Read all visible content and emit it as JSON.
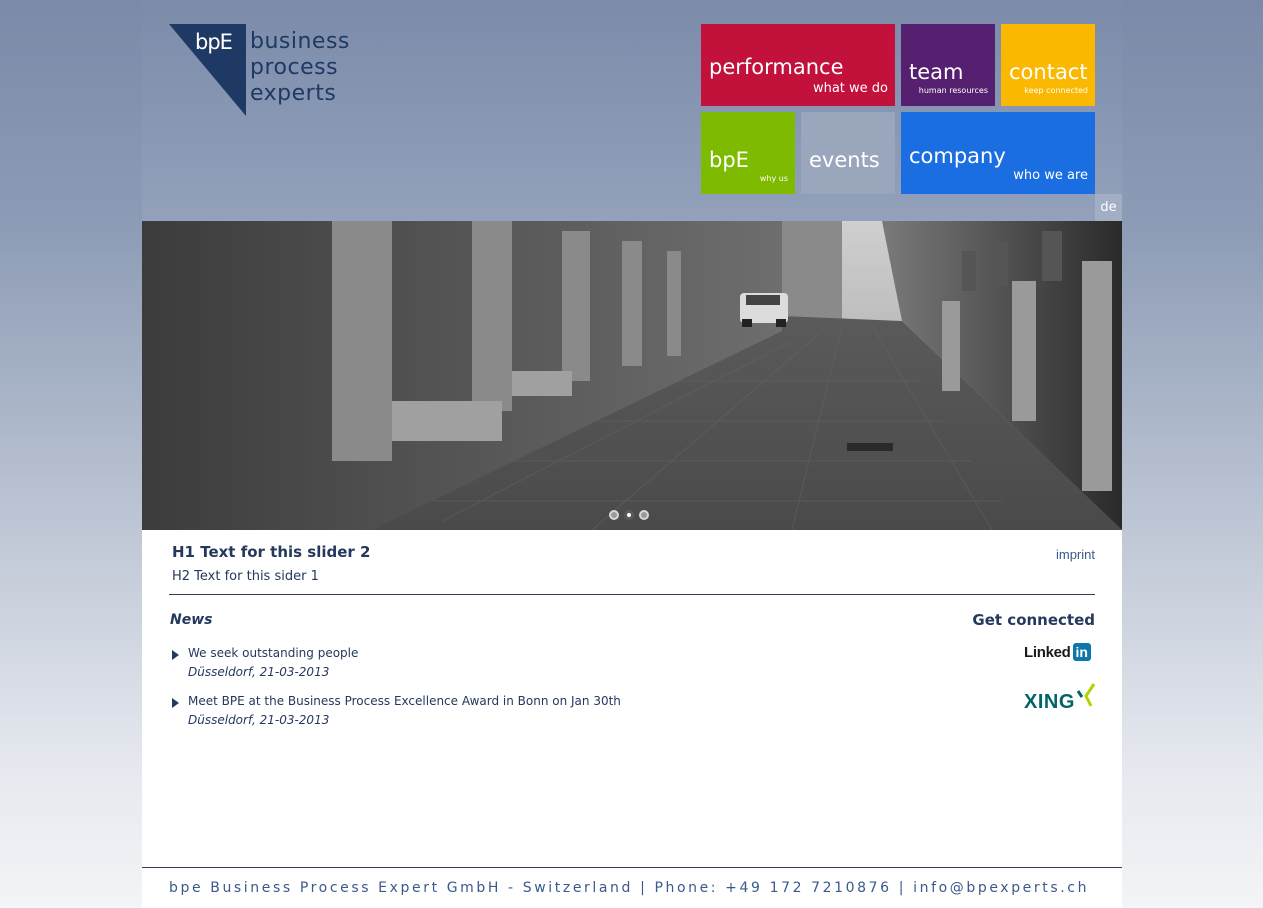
{
  "logo": {
    "mark": "bpE",
    "lines": [
      "business",
      "process",
      "experts"
    ]
  },
  "nav": {
    "performance": {
      "label": "performance",
      "sub": "what we do",
      "color": "#c2123c"
    },
    "team": {
      "label": "team",
      "sub": "human resources",
      "color": "#55206f"
    },
    "contact": {
      "label": "contact",
      "sub": "keep connected",
      "color": "#fbb800"
    },
    "bpe": {
      "label": "bpE",
      "sub": "why us",
      "color": "#7dba00"
    },
    "events": {
      "label": "events",
      "color": "#9aa6bb"
    },
    "company": {
      "label": "company",
      "sub": "who we are",
      "color": "#1b6ee2"
    }
  },
  "lang": "de",
  "slider": {
    "dots": 3,
    "active_index": 1
  },
  "content": {
    "h1": "H1 Text for this slider 2",
    "h2": "H2 Text for this sider 1",
    "imprint": "imprint"
  },
  "news": {
    "title": "News",
    "items": [
      {
        "title": "We seek outstanding people",
        "date": "Düsseldorf, 21-03-2013"
      },
      {
        "title": "Meet BPE at the Business Process Excellence Award in Bonn on Jan 30th",
        "date": "Düsseldorf, 21-03-2013"
      }
    ]
  },
  "social": {
    "title": "Get connected",
    "linkedin_text": "Linked",
    "linkedin_box": "in",
    "xing": "XING"
  },
  "footer": {
    "text": "bpe Business Process Expert GmbH - Switzerland | Phone: +49 172 7210876 | info@bpexperts.ch"
  }
}
